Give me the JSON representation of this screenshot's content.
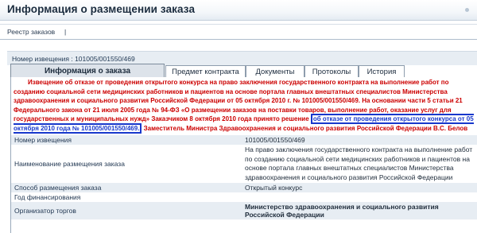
{
  "page": {
    "title": "Информация о размещении заказа"
  },
  "breadcrumb": {
    "link": "Реестр заказов",
    "separator": "|"
  },
  "notice": {
    "header": "Номер извещения : 101005/001550/469"
  },
  "tabs": [
    {
      "label": "Информация о заказа",
      "active": true
    },
    {
      "label": "Предмет контракта",
      "active": false
    },
    {
      "label": "Документы",
      "active": false
    },
    {
      "label": "Протоколы",
      "active": false
    },
    {
      "label": "История",
      "active": false
    }
  ],
  "alert": {
    "before": "Извещение об отказе от проведения открытого конкурса на право заключения государственного контракта на выполнение работ по созданию социальной сети медицинских работников и пациентов на основе портала главных внештатных специалистов Министерства здравоохранения и социального развития Российской Федерации от 05 октября 2010 г. № 101005/001550/469. На основании части 5 статьи 21 Федерального закона от 21 июля 2005 года № 94-ФЗ «О размещении заказов на поставки товаров, выполнение работ, оказание услуг для государственных и муниципальных нужд» Заказчиком 8 октября 2010 года принято решение",
    "highlight": "об отказе от проведения открытого конкурса от 05 октября 2010 года № 101005/001550/469.",
    "after": "Заместитель Министра Здравоохранения и социального развития Российской Федерации В.С. Белов"
  },
  "details": [
    {
      "label": "Номер извещения",
      "value": "101005/001550/469",
      "bold": false
    },
    {
      "label": "Наименование размещения заказа",
      "value": "На право заключения государственного контракта на выполнение работ по созданию социальной сети медицинских работников и пациентов на основе портала главных внештатных специалистов Министерства здравоохранения и социального развития Российской Федерации",
      "bold": false
    },
    {
      "label": "Способ размещения заказа",
      "value": "Открытый конкурс",
      "bold": false
    },
    {
      "label": "Год финансирования",
      "value": "",
      "bold": false
    },
    {
      "label": "Организатор торгов",
      "value": "Министерство здравоохранения и социального развития Российской Федерации",
      "bold": true
    }
  ],
  "colors": {
    "alert_text": "#cc0000",
    "highlight_border": "#1838cc",
    "row_alt_bg": "#e7edf3",
    "active_tab_bg": "#dde3ea"
  }
}
